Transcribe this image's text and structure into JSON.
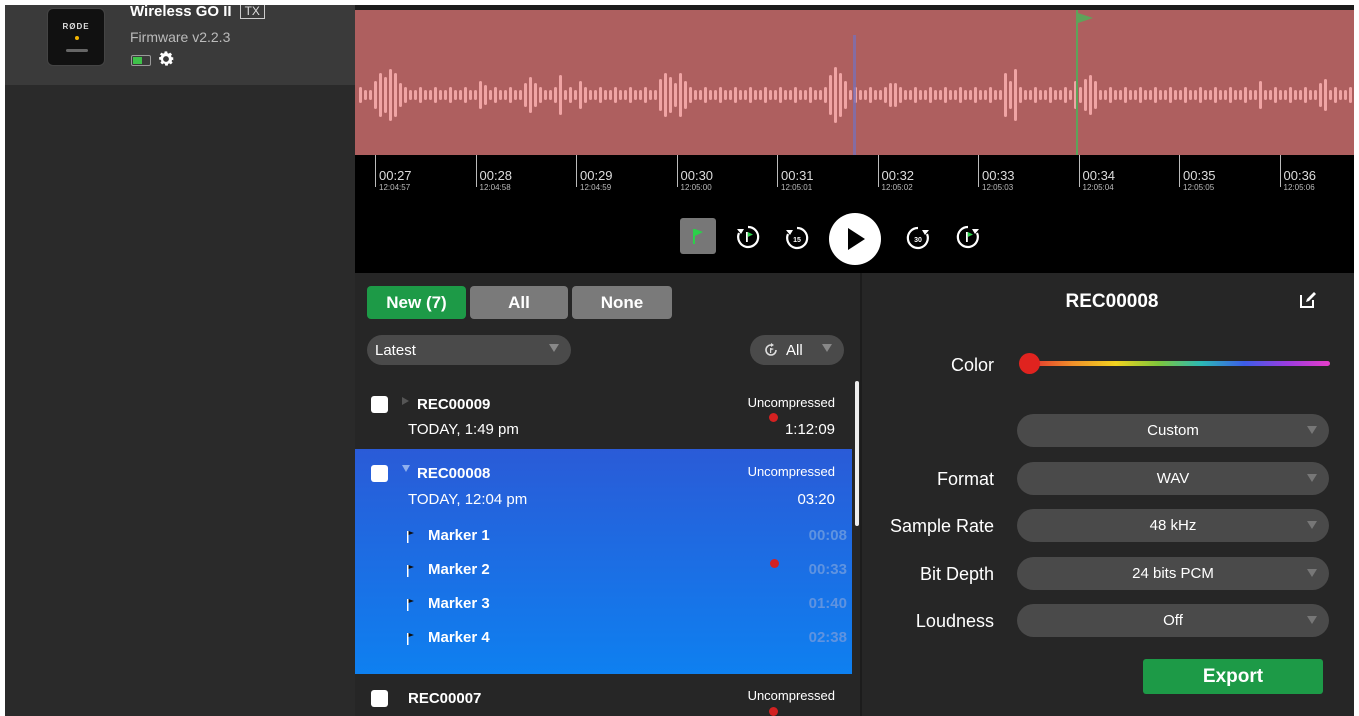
{
  "device": {
    "name": "Wireless GO II",
    "tag": "TX",
    "firmware": "Firmware v2.2.3",
    "brand": "RØDE"
  },
  "timeline": {
    "ticks": [
      {
        "time": "00:27",
        "clock": "12:04:57"
      },
      {
        "time": "00:28",
        "clock": "12:04:58"
      },
      {
        "time": "00:29",
        "clock": "12:04:59"
      },
      {
        "time": "00:30",
        "clock": "12:05:00"
      },
      {
        "time": "00:31",
        "clock": "12:05:01"
      },
      {
        "time": "00:32",
        "clock": "12:05:02"
      },
      {
        "time": "00:33",
        "clock": "12:05:03"
      },
      {
        "time": "00:34",
        "clock": "12:05:04"
      },
      {
        "time": "00:35",
        "clock": "12:05:05"
      },
      {
        "time": "00:36",
        "clock": "12:05:06"
      }
    ]
  },
  "transport": {
    "skip_back_label": "15",
    "skip_forward_label": "30",
    "buttons": [
      "add-marker-icon",
      "previous-marker-icon",
      "skip-back-15-icon",
      "play-icon",
      "skip-forward-30-icon",
      "next-marker-icon"
    ]
  },
  "filters": {
    "new_label": "New (7)",
    "all_label": "All",
    "none_label": "None",
    "sort_value": "Latest",
    "flag_filter_value": "All"
  },
  "recordings": [
    {
      "name": "REC00009",
      "date": "TODAY, 1:49 pm",
      "format": "Uncompressed",
      "duration": "1:12:09"
    },
    {
      "name": "REC00008",
      "date": "TODAY, 12:04 pm",
      "format": "Uncompressed",
      "duration": "03:20",
      "markers": [
        {
          "name": "Marker 1",
          "time": "00:08"
        },
        {
          "name": "Marker 2",
          "time": "00:33"
        },
        {
          "name": "Marker 3",
          "time": "01:40"
        },
        {
          "name": "Marker 4",
          "time": "02:38"
        }
      ]
    },
    {
      "name": "REC00007",
      "format": "Uncompressed"
    }
  ],
  "detail": {
    "title": "REC00008",
    "color_label": "Color",
    "color_value": "#e0231f",
    "preset_value": "Custom",
    "format_label": "Format",
    "format_value": "WAV",
    "sample_rate_label": "Sample Rate",
    "sample_rate_value": "48 kHz",
    "bit_depth_label": "Bit Depth",
    "bit_depth_value": "24 bits PCM",
    "loudness_label": "Loudness",
    "loudness_value": "Off",
    "export_label": "Export"
  },
  "colors": {
    "waveform_bg": "#ae5f5f",
    "waveform_bars": "#f0a4a4",
    "selected_row": "#2a5bd7",
    "export": "#1d9a47",
    "new_filter": "#1d9a47",
    "marker_time": "#5f93e0"
  }
}
